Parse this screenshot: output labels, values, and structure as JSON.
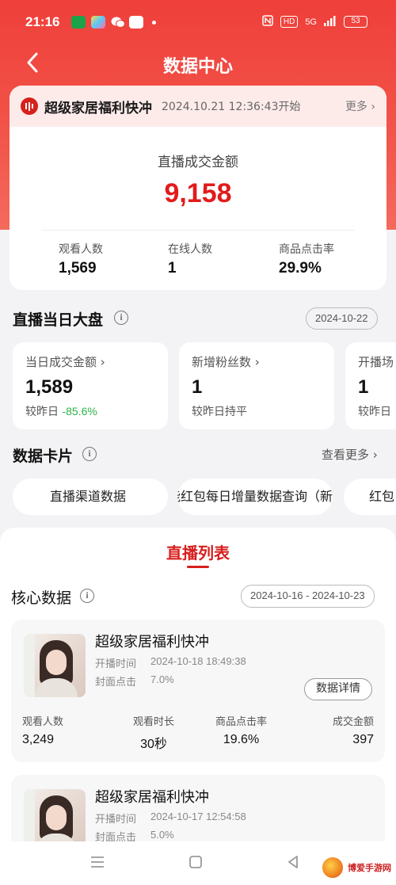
{
  "status_bar": {
    "time": "21:16",
    "hd": "HD",
    "network": "5G",
    "battery": "53"
  },
  "nav": {
    "title": "数据中心"
  },
  "live": {
    "name": "超级家居福利快冲",
    "start_time": "2024.10.21 12:36:43开始",
    "more": "更多",
    "total_label": "直播成交金额",
    "total_value": "9,158",
    "stats": [
      {
        "label": "观看人数",
        "value": "1,569"
      },
      {
        "label": "在线人数",
        "value": "1"
      },
      {
        "label": "商品点击率",
        "value": "29.9%"
      }
    ]
  },
  "overview": {
    "title": "直播当日大盘",
    "date": "2024-10-22",
    "metrics": [
      {
        "label": "当日成交金额",
        "value": "1,589",
        "cmp_prefix": "较昨日 ",
        "cmp_value": "-85.6%"
      },
      {
        "label": "新增粉丝数",
        "value": "1",
        "cmp_prefix": "较昨日持平",
        "cmp_value": ""
      },
      {
        "label": "开播场",
        "value": "1",
        "cmp_prefix": "较昨日",
        "cmp_value": ""
      }
    ]
  },
  "cards": {
    "title": "数据卡片",
    "more": "查看更多",
    "chips": [
      "直播渠道数据",
      "万能红包每日增量数据查询（新",
      "红包"
    ]
  },
  "list": {
    "tab": "直播列表",
    "core_title": "核心数据",
    "date_range": "2024-10-16 - 2024-10-23",
    "sessions": [
      {
        "name": "超级家居福利快冲",
        "start_label": "开播时间",
        "start_value": "2024-10-18 18:49:38",
        "cover_label": "封面点击",
        "cover_value": "7.0%",
        "detail": "数据详情",
        "stats": [
          {
            "label": "观看人数",
            "value": "3,249"
          },
          {
            "label": "观看时长",
            "value": "30秒"
          },
          {
            "label": "商品点击率",
            "value": "19.6%"
          },
          {
            "label": "成交金额",
            "value": "397"
          }
        ]
      },
      {
        "name": "超级家居福利快冲",
        "start_label": "开播时间",
        "start_value": "2024-10-17 12:54:58",
        "cover_label": "封面点击",
        "cover_value": "5.0%"
      }
    ]
  },
  "watermark": {
    "text": "博爱手游网"
  },
  "colors": {
    "brand_red": "#e21b1b",
    "header_red": "#ef3f3a",
    "positive_green": "#2fb34a"
  }
}
